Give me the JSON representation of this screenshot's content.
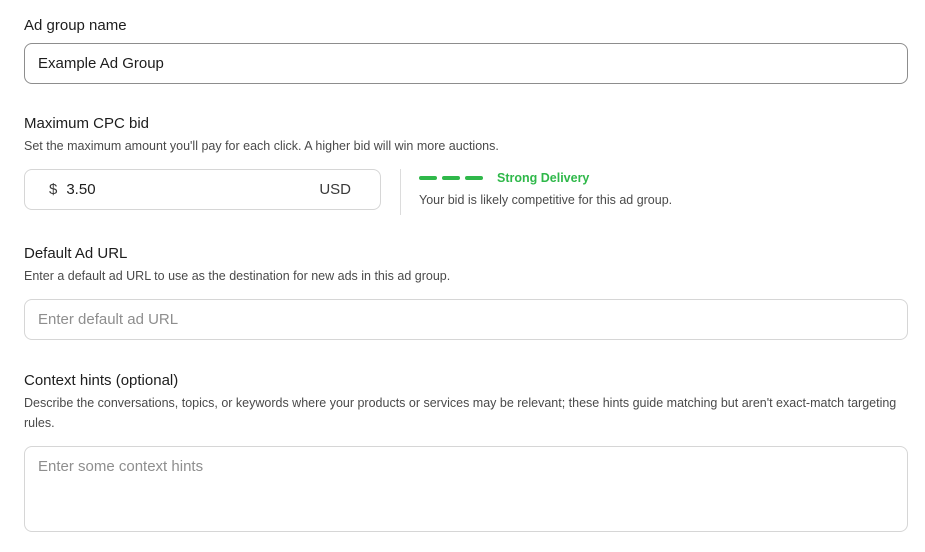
{
  "ad_group_name": {
    "label": "Ad group name",
    "value": "Example Ad Group"
  },
  "max_cpc_bid": {
    "label": "Maximum CPC bid",
    "description": "Set the maximum amount you'll pay for each click. A higher bid will win more auctions.",
    "currency_symbol": "$",
    "value": "3.50",
    "currency_code": "USD",
    "delivery": {
      "strength_label": "Strong Delivery",
      "strength_level": 3,
      "strength_max": 3,
      "note": "Your bid is likely competitive for this ad group.",
      "color": "#2fb84a"
    }
  },
  "default_ad_url": {
    "label": "Default Ad URL",
    "description": "Enter a default ad URL to use as the destination for new ads in this ad group.",
    "placeholder": "Enter default ad URL",
    "value": ""
  },
  "context_hints": {
    "label": "Context hints (optional)",
    "description": "Describe the conversations, topics, or keywords where your products or services may be relevant; these hints guide matching but aren't exact-match targeting rules.",
    "placeholder": "Enter some context hints",
    "value": ""
  }
}
